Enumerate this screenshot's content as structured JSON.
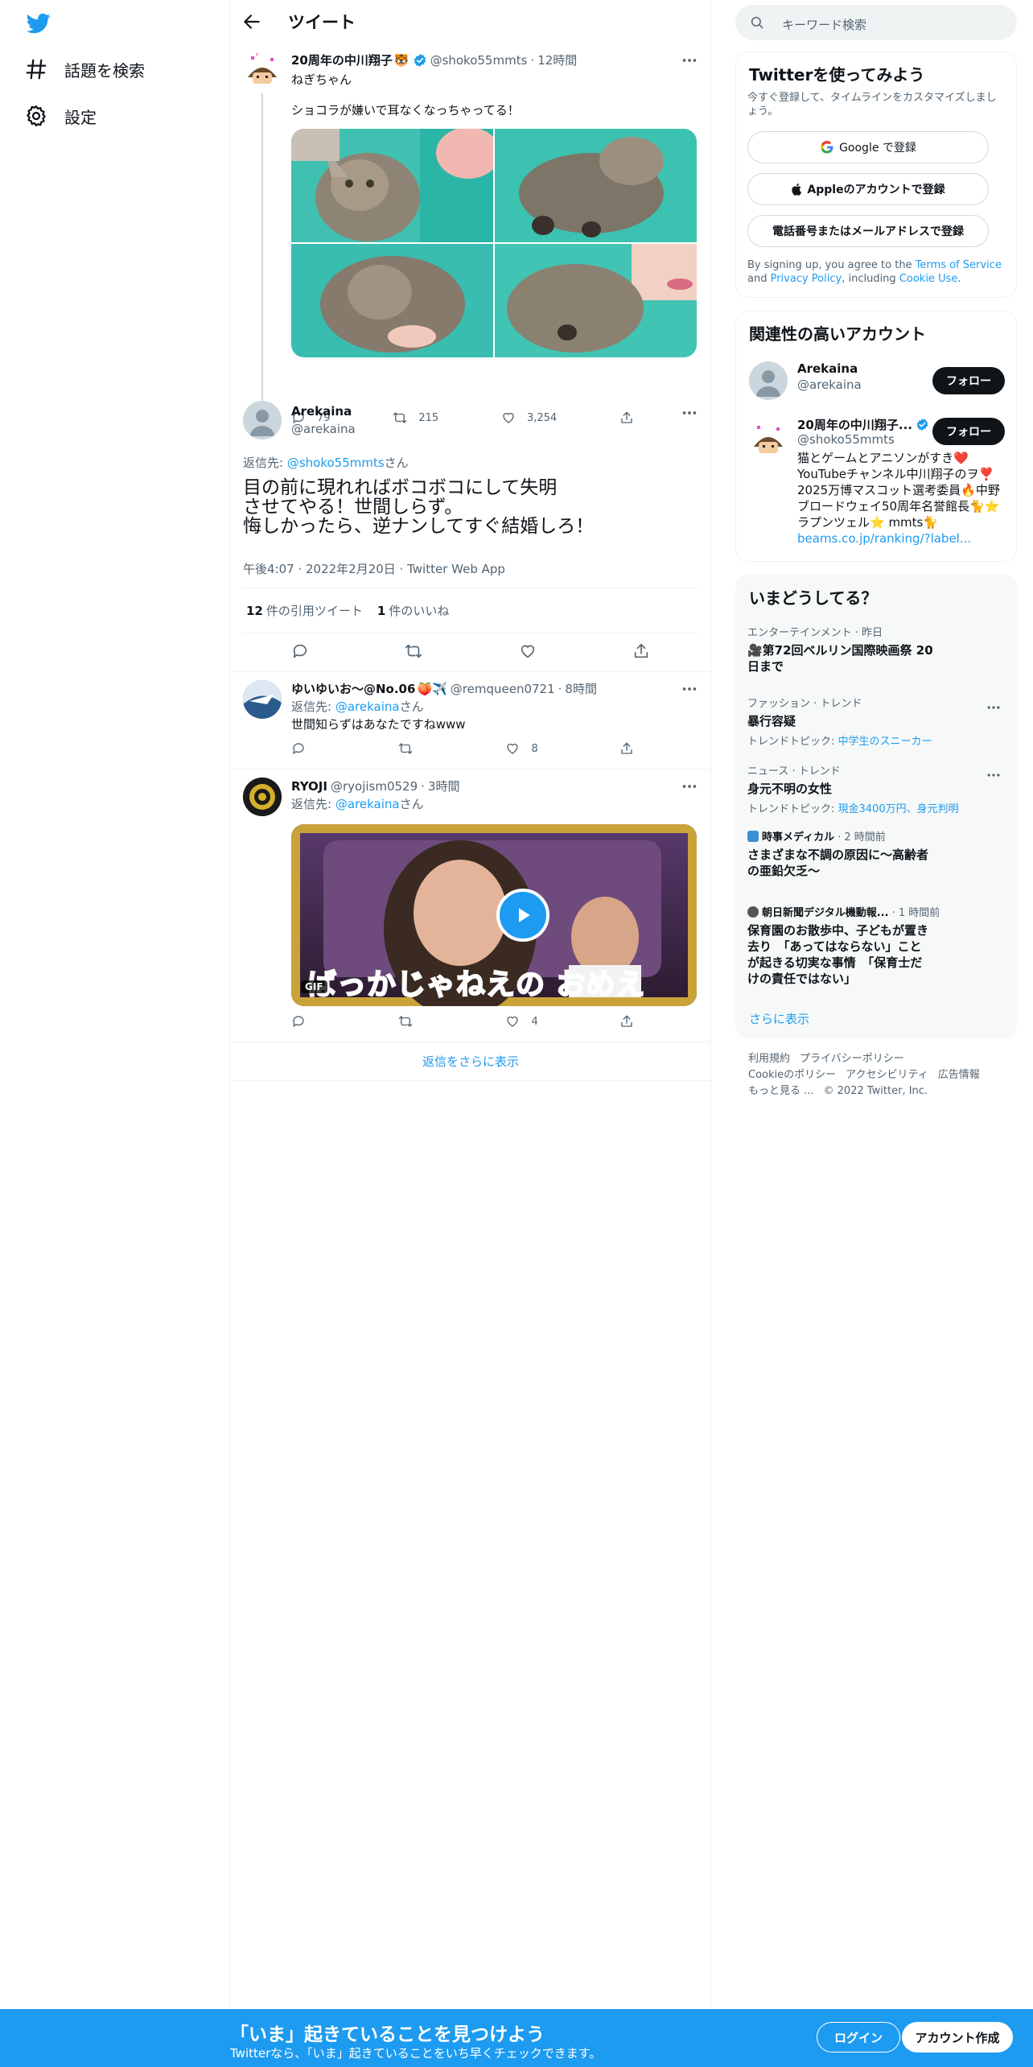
{
  "nav": {
    "explore_label": "話題を検索",
    "settings_label": "設定"
  },
  "header": {
    "title": "ツイート"
  },
  "parent_tweet": {
    "name": "20周年の中川翔子",
    "emoji": "🐯",
    "handle": "@shoko55mmts",
    "time": "12時間",
    "lead": "ねぎちゃん",
    "text": "ショコラが嫌いで耳なくなっちゃってる！",
    "replies": "79",
    "retweets": "215",
    "likes": "3,254"
  },
  "focal_tweet": {
    "name": "Arekaina",
    "handle": "@arekaina",
    "reply_prefix": "返信先: ",
    "reply_to": "@shoko55mmts",
    "reply_suffix": "さん",
    "line1": "目の前に現れればボコボコにして失明",
    "line2": "させてやる！世間しらず。",
    "line3": "悔しかったら、逆ナンしてすぐ結婚しろ！",
    "meta": "午後4:07 · 2022年2月20日 · Twitter Web App",
    "quote_count": "12",
    "quote_label": "件の引用ツイート",
    "like_count": "1",
    "like_label": "件のいいね"
  },
  "reply1": {
    "name": "ゆいゆいお〜@No.06",
    "emoji": "🍑✈️",
    "handle": "@remqueen0721",
    "time": "8時間",
    "reply_prefix": "返信先: ",
    "reply_to": "@arekaina",
    "reply_suffix": "さん",
    "text": "世間知らずはあなたですねwww",
    "likes": "8"
  },
  "reply2": {
    "name": "RYOJI",
    "handle": "@ryojism0529",
    "time": "3時間",
    "reply_prefix": "返信先: ",
    "reply_to": "@arekaina",
    "reply_suffix": "さん",
    "gif_badge": "GIF",
    "gif_caption": "ばっかじゃねえの おめえ",
    "likes": "4"
  },
  "show_more_replies": "返信をさらに表示",
  "search": {
    "placeholder": "キーワード検索"
  },
  "signup_card": {
    "title": "Twitterを使ってみよう",
    "subtitle": "今すぐ登録して、タイムラインをカスタマイズしましょう。",
    "google": "Google で登録",
    "apple": "Appleのアカウントで登録",
    "phone": "電話番号またはメールアドレスで登録",
    "legal_1": "By signing up, you agree to the ",
    "tos": "Terms of Service",
    "legal_2": " and ",
    "privacy": "Privacy Policy",
    "legal_3": ", including ",
    "cookie": "Cookie Use",
    "legal_4": "."
  },
  "relevant": {
    "title": "関連性の高いアカウント",
    "follow": "フォロー",
    "accounts": [
      {
        "name": "Arekaina",
        "handle": "@arekaina"
      },
      {
        "name": "20周年の中川翔子...",
        "handle": "@shoko55mmts",
        "bio1": "猫とゲームとアニソンがすき❤️",
        "bio2": "YouTubeチャンネル中川翔子のヲ❣️",
        "bio3": "2025万博マスコット選考委員🔥中野",
        "bio4": "ブロードウェイ50周年名誉館長🐈⭐",
        "bio5": "ラプンツェル⭐ mmts🐈",
        "link": "beams.co.jp/ranking/?label..."
      }
    ]
  },
  "trends": {
    "title": "いまどうしてる？",
    "items": [
      {
        "cat": "エンターテインメント · 昨日",
        "title1": "🎥第72回ベルリン国際映画祭 20",
        "title2": "日まで"
      },
      {
        "cat": "ファッション · トレンド",
        "title1": "暴行容疑",
        "sub_prefix": "トレンドトピック: ",
        "sub_link": "中学生のスニーカー"
      },
      {
        "cat": "ニュース · トレンド",
        "title1": "身元不明の女性",
        "sub_prefix": "トレンドトピック: ",
        "sub_link": "現金3400万円、身元判明"
      },
      {
        "source": "時事メディカル",
        "time": "· 2 時間前",
        "title1": "さまざまな不調の原因に～高齢者",
        "title2": "の亜鉛欠乏～"
      },
      {
        "source": "朝日新聞デジタル機動報...",
        "time": "· 1 時間前",
        "title1": "保育園のお散歩中、子どもが置き",
        "title2": "去り　「あってはならない」こと",
        "title3": "が起きる切実な事情　「保育士だ",
        "title4": "けの責任ではない」"
      }
    ],
    "show_more": "さらに表示"
  },
  "footer": {
    "terms": "利用規約",
    "privacy": "プライバシーポリシー",
    "cookie": "Cookieのポリシー",
    "access": "アクセシビリティ",
    "ads": "広告情報",
    "more": "もっと見る ...",
    "copyright": "© 2022 Twitter, Inc."
  },
  "bottom_bar": {
    "title": "「いま」起きていることを見つけよう",
    "subtitle": "Twitterなら、「いま」起きていることをいち早くチェックできます。",
    "login": "ログイン",
    "signup": "アカウント作成"
  },
  "colors": {
    "accent": "#1d9bf0",
    "text": "#0f1419",
    "muted": "#536471",
    "border": "#eff3f4"
  }
}
